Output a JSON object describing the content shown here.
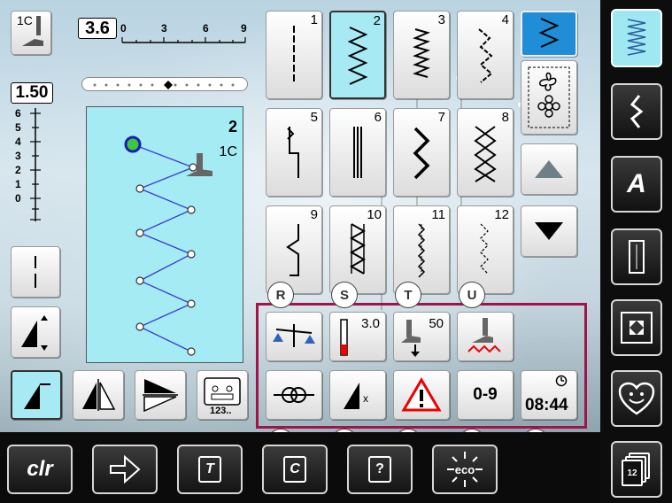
{
  "top_left": {
    "presser_foot": "1C",
    "stitch_length": "3.6",
    "stitch_length_scale": [
      "0",
      "3",
      "6",
      "9"
    ],
    "stitch_width": "1.50",
    "width_scale": [
      "6",
      "5",
      "4",
      "3",
      "2",
      "1",
      "0"
    ],
    "slider_position": 0.48
  },
  "preview": {
    "stitch_number": "2",
    "foot": "1C"
  },
  "stitches": [
    {
      "num": "1"
    },
    {
      "num": "2"
    },
    {
      "num": "3"
    },
    {
      "num": "4"
    },
    {
      "num": "5"
    },
    {
      "num": "6"
    },
    {
      "num": "7"
    },
    {
      "num": "8"
    },
    {
      "num": "9"
    },
    {
      "num": "10"
    },
    {
      "num": "11"
    },
    {
      "num": "12"
    }
  ],
  "function_panel": {
    "needle_stop_value": "3.0",
    "presser_value": "50",
    "counter_label": "0-9",
    "clock": "08:44",
    "memory_label": "123.."
  },
  "letters": [
    "R",
    "S",
    "T",
    "U",
    "V",
    "W",
    "X",
    "Y",
    "Z"
  ],
  "bottom": {
    "clr": "clr",
    "t_label": "T",
    "c_label": "C",
    "help_label": "?",
    "eco_label": "eco"
  },
  "sidebar": {
    "font_label": "A",
    "page_label": "12"
  },
  "colors": {
    "selection": "#a7eaf4",
    "highlight_frame": "#a0144a",
    "sidebar_bg": "#0d0d0d"
  }
}
